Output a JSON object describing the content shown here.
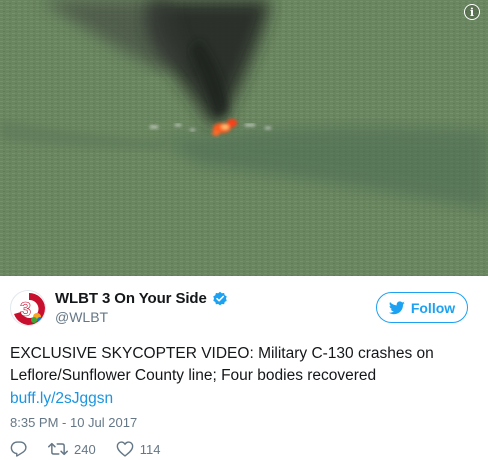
{
  "media": {
    "info_icon": "info-icon",
    "description_colors": {
      "grass": "#6a8660",
      "shadow": "#4f6b52",
      "smoke": "#2a2d2a",
      "fire": "#ff4a1a"
    }
  },
  "author": {
    "display_name": "WLBT 3 On Your Side",
    "handle": "@WLBT",
    "verified": true,
    "avatar_text": "3"
  },
  "follow_button": {
    "label": "Follow",
    "color": "#1da1f2"
  },
  "tweet": {
    "text": "EXCLUSIVE SKYCOPTER VIDEO: Military C-130 crashes on Leflore/Sunflower County line; Four bodies recovered",
    "link": "buff.ly/2sJggsn",
    "timestamp": "8:35 PM - 10 Jul 2017"
  },
  "actions": {
    "reply_icon": "reply-icon",
    "retweet_icon": "retweet-icon",
    "retweet_count": "240",
    "like_icon": "heart-icon",
    "like_count": "114"
  }
}
